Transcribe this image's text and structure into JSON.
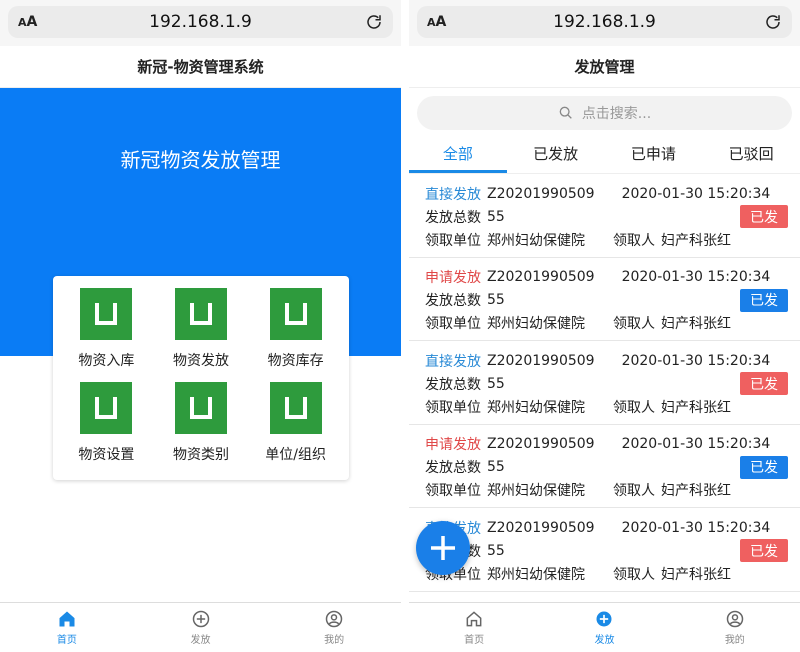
{
  "browser": {
    "aa_small": "A",
    "aa_big": "A",
    "url": "192.168.1.9"
  },
  "left": {
    "nav_title": "新冠-物资管理系统",
    "hero_title": "新冠物资发放管理",
    "grid": [
      {
        "label": "物资入库"
      },
      {
        "label": "物资发放"
      },
      {
        "label": "物资库存"
      },
      {
        "label": "物资设置"
      },
      {
        "label": "物资类别"
      },
      {
        "label": "单位/组织"
      }
    ],
    "tabbar": [
      {
        "label": "首页",
        "icon": "home-icon",
        "active": true
      },
      {
        "label": "发放",
        "icon": "plus-circle-icon",
        "active": false
      },
      {
        "label": "我的",
        "icon": "user-icon",
        "active": false
      }
    ]
  },
  "right": {
    "nav_title": "发放管理",
    "search_placeholder": "点击搜索...",
    "tabs": [
      {
        "label": "全部",
        "active": true
      },
      {
        "label": "已发放",
        "active": false
      },
      {
        "label": "已申请",
        "active": false
      },
      {
        "label": "已驳回",
        "active": false
      }
    ],
    "records": [
      {
        "type": "直接发放",
        "code": "Z20201990509",
        "time": "2020-01-30 15:20:34",
        "total_label": "发放总数",
        "total": "55",
        "unit_label": "领取单位",
        "unit": "郑州妇幼保健院",
        "person_label": "领取人",
        "person": "妇产科张红",
        "status": "已发",
        "status_color": "#ef6060"
      },
      {
        "type": "申请发放",
        "code": "Z20201990509",
        "time": "2020-01-30 15:20:34",
        "total_label": "发放总数",
        "total": "55",
        "unit_label": "领取单位",
        "unit": "郑州妇幼保健院",
        "person_label": "领取人",
        "person": "妇产科张红",
        "status": "已发",
        "status_color": "#1a7fe8"
      },
      {
        "type": "直接发放",
        "code": "Z20201990509",
        "time": "2020-01-30 15:20:34",
        "total_label": "发放总数",
        "total": "55",
        "unit_label": "领取单位",
        "unit": "郑州妇幼保健院",
        "person_label": "领取人",
        "person": "妇产科张红",
        "status": "已发",
        "status_color": "#ef6060"
      },
      {
        "type": "申请发放",
        "code": "Z20201990509",
        "time": "2020-01-30 15:20:34",
        "total_label": "发放总数",
        "total": "55",
        "unit_label": "领取单位",
        "unit": "郑州妇幼保健院",
        "person_label": "领取人",
        "person": "妇产科张红",
        "status": "已发",
        "status_color": "#1a7fe8"
      },
      {
        "type": "直接发放",
        "code": "Z20201990509",
        "time": "2020-01-30 15:20:34",
        "total_label": "发放总数",
        "total": "55",
        "unit_label": "领取单位",
        "unit": "郑州妇幼保健院",
        "person_label": "领取人",
        "person": "妇产科张红",
        "status": "已发",
        "status_color": "#ef6060"
      }
    ],
    "tabbar": [
      {
        "label": "首页",
        "icon": "home-icon",
        "active": false
      },
      {
        "label": "发放",
        "icon": "plus-circle-icon",
        "active": true
      },
      {
        "label": "我的",
        "icon": "user-icon",
        "active": false
      }
    ]
  },
  "colors": {
    "brand_blue": "#0a7cf5",
    "tile_green": "#2e9b3d",
    "reject_red": "#ef6060"
  }
}
